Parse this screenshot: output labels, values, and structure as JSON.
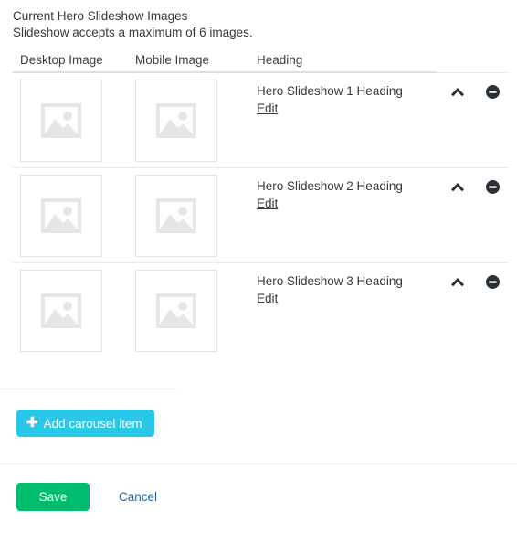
{
  "section": {
    "title": "Current Hero Slideshow Images",
    "subtitle": "Slideshow accepts a maximum of 6 images."
  },
  "table": {
    "columns": {
      "desktop": "Desktop Image",
      "mobile": "Mobile Image",
      "heading": "Heading"
    },
    "rows": [
      {
        "heading": "Hero Slideshow 1 Heading",
        "edit_label": "Edit",
        "desktop_image": "image-placeholder",
        "mobile_image": "image-placeholder",
        "move_up_icon": "chevron-up-icon",
        "remove_icon": "minus-circle-icon"
      },
      {
        "heading": "Hero Slideshow 2 Heading",
        "edit_label": "Edit",
        "desktop_image": "image-placeholder",
        "mobile_image": "image-placeholder",
        "move_up_icon": "chevron-up-icon",
        "remove_icon": "minus-circle-icon"
      },
      {
        "heading": "Hero Slideshow 3 Heading",
        "edit_label": "Edit",
        "desktop_image": "image-placeholder",
        "mobile_image": "image-placeholder",
        "move_up_icon": "chevron-up-icon",
        "remove_icon": "minus-circle-icon"
      }
    ]
  },
  "actions": {
    "add_label": "Add carousel item",
    "add_icon": "plus-icon",
    "save_label": "Save",
    "cancel_label": "Cancel"
  },
  "colors": {
    "add_button": "#2ac7e8",
    "save_button": "#00bd6d",
    "cancel_link": "#1266bc",
    "text": "#35383d",
    "divider": "#e9eaea",
    "thumb_border": "#e2e4e5",
    "placeholder_fill": "#e4e6e7"
  }
}
